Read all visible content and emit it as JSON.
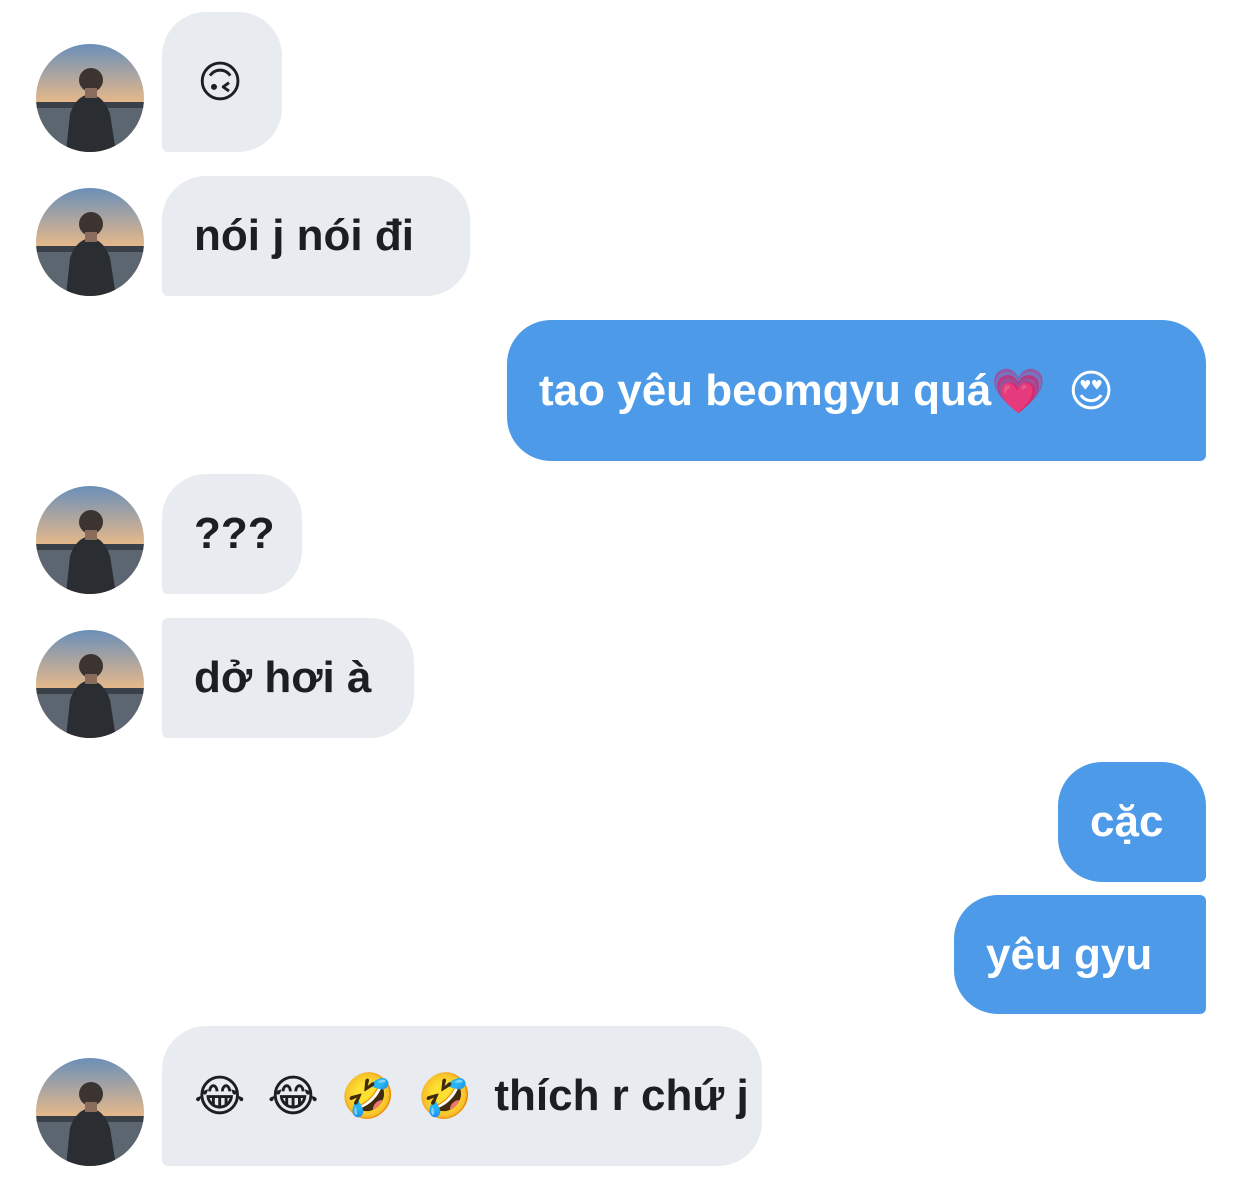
{
  "messages": [
    {
      "side": "received",
      "text": "🙃"
    },
    {
      "side": "received",
      "text": "nói j nói đi"
    },
    {
      "side": "sent",
      "text": "tao yêu beomgyu quá",
      "emoji": "💗 😍"
    },
    {
      "side": "received",
      "text": "???"
    },
    {
      "side": "received",
      "text": "dở hơi à"
    },
    {
      "side": "sent",
      "text": "cặc"
    },
    {
      "side": "sent",
      "text": "yêu gyu"
    },
    {
      "side": "received",
      "emoji": "😂 😂 🤣 🤣",
      "text": "thích r chứ j"
    }
  ],
  "colors": {
    "received_bubble": "#e8ebef",
    "sent_bubble": "#4d9be8",
    "received_text": "#1c1e21",
    "sent_text": "#ffffff"
  },
  "avatar": {
    "icon": "avatar-photo-person-at-sunset"
  }
}
